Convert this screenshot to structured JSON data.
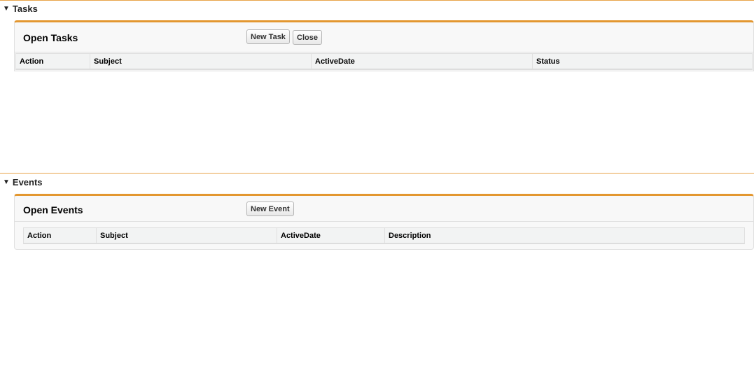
{
  "tasks": {
    "section_title": "Tasks",
    "panel_title": "Open Tasks",
    "new_button": "New Task",
    "close_button": "Close",
    "columns": [
      "Action",
      "Subject",
      "ActiveDate",
      "Status"
    ]
  },
  "events": {
    "section_title": "Events",
    "panel_title": "Open Events",
    "new_button": "New Event",
    "columns": [
      "Action",
      "Subject",
      "ActiveDate",
      "Description"
    ]
  }
}
